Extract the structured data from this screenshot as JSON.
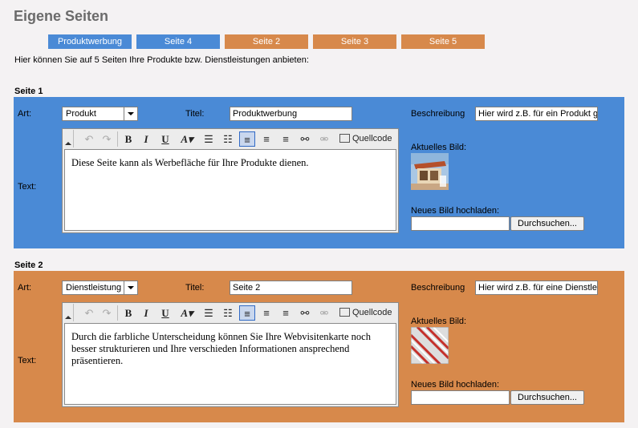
{
  "page": {
    "title": "Eigene Seiten",
    "intro": "Hier können Sie auf 5 Seiten Ihre Produkte bzw. Dienstleistungen anbieten:"
  },
  "tabs": [
    {
      "label": "Produktwerbung",
      "color": "#4a8ad6"
    },
    {
      "label": "Seite 4",
      "color": "#4a8ad6"
    },
    {
      "label": "Seite 2",
      "color": "#d7894b"
    },
    {
      "label": "Seite 3",
      "color": "#d7894b"
    },
    {
      "label": "Seite 5",
      "color": "#d7894b"
    }
  ],
  "labels": {
    "art": "Art:",
    "titel": "Titel:",
    "beschreibung": "Beschreibung",
    "text": "Text:",
    "current_image": "Aktuelles Bild:",
    "upload": "Neues Bild hochladen:",
    "browse": "Durchsuchen...",
    "source": "Quellcode"
  },
  "toolbar_icons": [
    "undo-icon",
    "redo-icon",
    "bold-icon",
    "italic-icon",
    "underline-icon",
    "font-size-icon",
    "ordered-list-icon",
    "unordered-list-icon",
    "align-left-icon",
    "align-center-icon",
    "align-right-icon",
    "link-icon",
    "unlink-icon",
    "source-icon"
  ],
  "sections": [
    {
      "heading": "Seite 1",
      "art": "Produkt",
      "titel": "Produktwerbung",
      "beschreibung": "Hier wird z.B. für ein Produkt ge",
      "text": "Diese Seite kann als Werbefläche für Ihre Produkte dienen.",
      "color": "#4a8ad6"
    },
    {
      "heading": "Seite 2",
      "art": "Dienstleistung",
      "titel": "Seite 2",
      "beschreibung": "Hier wird z.B. für eine Dienstleist",
      "text": "Durch die farbliche Unterscheidung können Sie Ihre Webvisitenkarte noch besser strukturieren und Ihre verschieden Informationen ansprechend präsentieren.",
      "color": "#d7894b"
    }
  ]
}
